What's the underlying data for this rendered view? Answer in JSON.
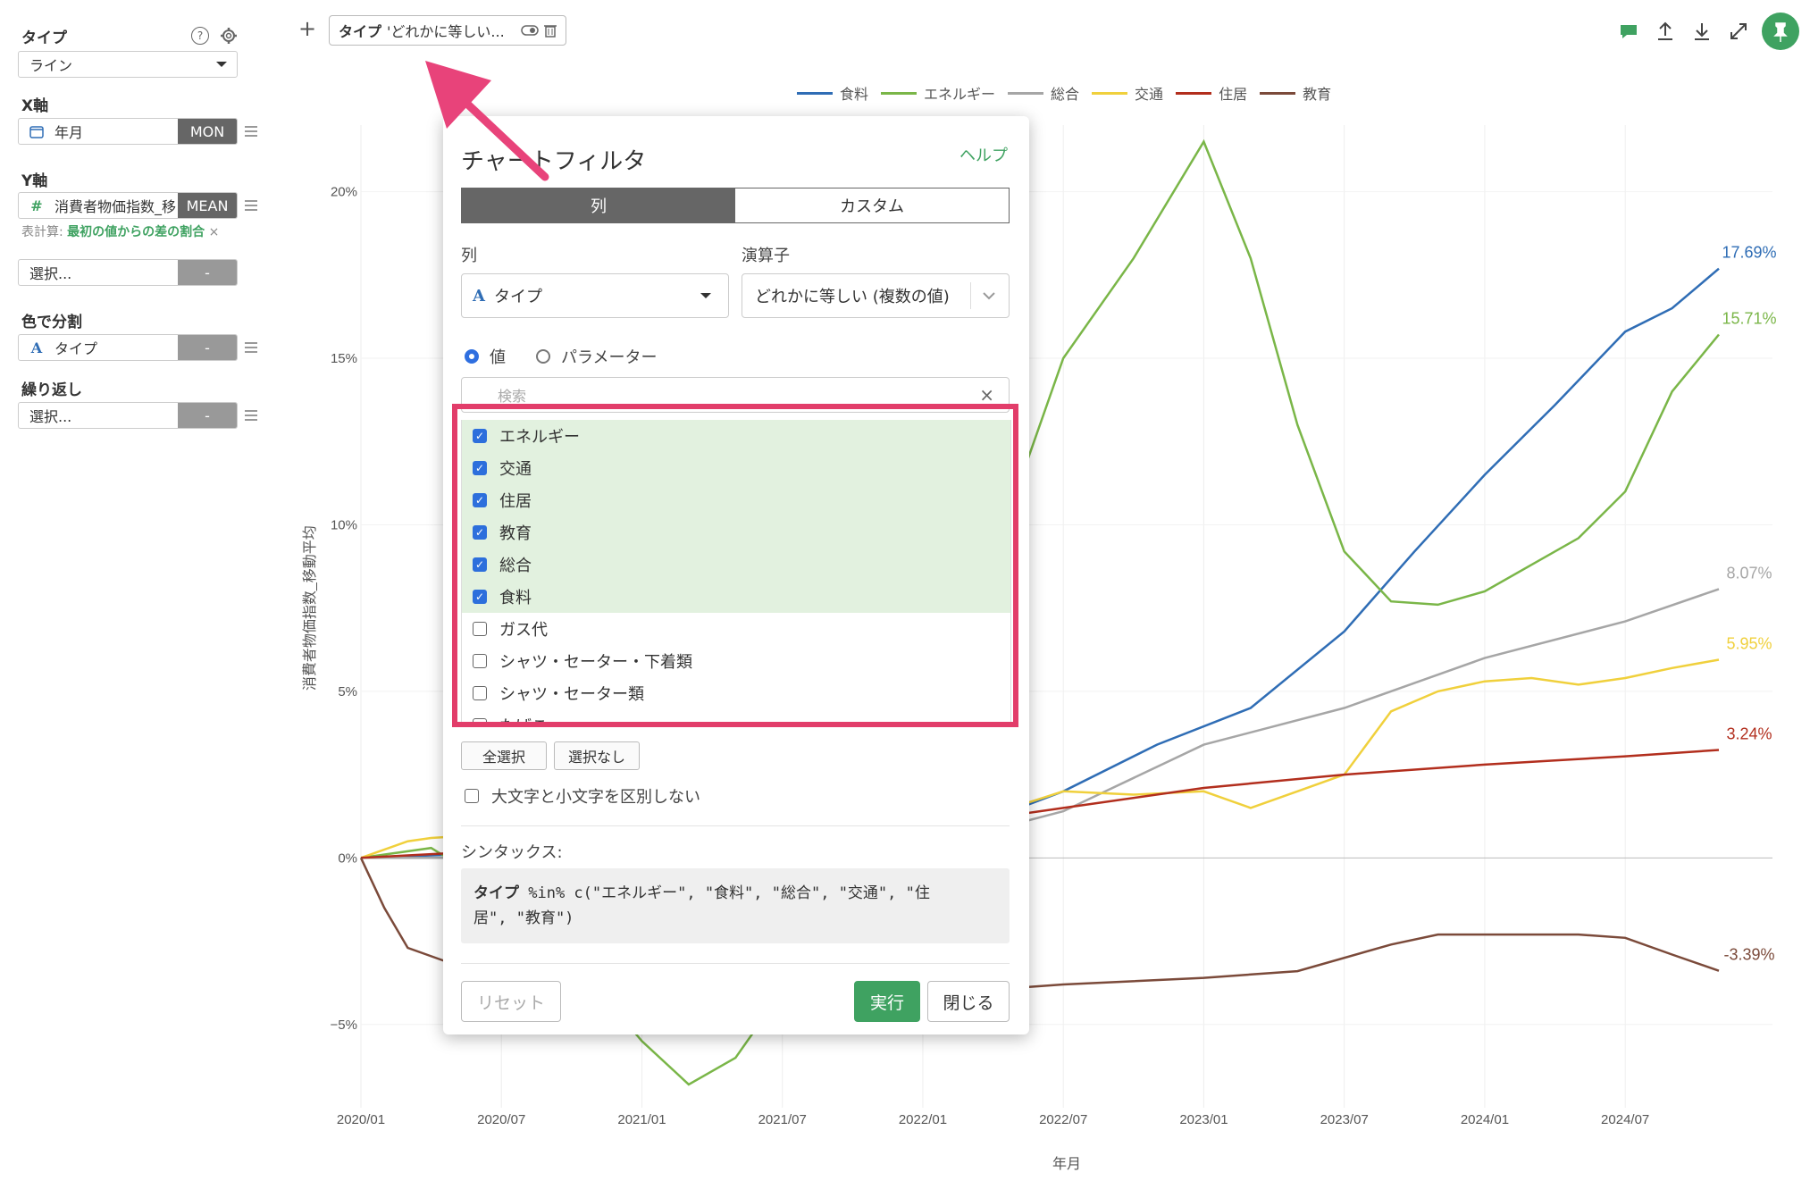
{
  "sidebar": {
    "type_label": "タイプ",
    "type_value": "ライン",
    "x_label": "X軸",
    "x_field": "年月",
    "x_agg": "MON",
    "y_label": "Y軸",
    "y_field": "消費者物価指数_移",
    "y_agg": "MEAN",
    "calc_prefix": "表計算:",
    "calc_value": "最初の値からの差の割合",
    "calc_close": "×",
    "select_placeholder": "選択...",
    "select_tag": "-",
    "color_label": "色で分割",
    "color_field": "タイプ",
    "color_tag": "-",
    "repeat_label": "繰り返し",
    "repeat_placeholder": "選択...",
    "repeat_tag": "-",
    "help_icon": "?"
  },
  "toolbar": {
    "add": "+",
    "filter_chip_key": "タイプ",
    "filter_chip_value": "'どれかに等しい..."
  },
  "dialog": {
    "title": "チャートフィルタ",
    "help": "ヘルプ",
    "tab_column": "列",
    "tab_custom": "カスタム",
    "column_label": "列",
    "column_icon": "A",
    "column_value": "タイプ",
    "operator_label": "演算子",
    "operator_value": "どれかに等しい (複数の値)",
    "radio_value": "値",
    "radio_param": "パラメーター",
    "search_placeholder": "検索",
    "search_clear": "×",
    "items": [
      {
        "label": "エネルギー",
        "checked": true
      },
      {
        "label": "交通",
        "checked": true
      },
      {
        "label": "住居",
        "checked": true
      },
      {
        "label": "教育",
        "checked": true
      },
      {
        "label": "総合",
        "checked": true
      },
      {
        "label": "食料",
        "checked": true
      },
      {
        "label": "ガス代",
        "checked": false
      },
      {
        "label": "シャツ・セーター・下着類",
        "checked": false
      },
      {
        "label": "シャツ・セーター類",
        "checked": false
      },
      {
        "label": "たばこ",
        "checked": false
      }
    ],
    "select_all": "全選択",
    "select_none": "選択なし",
    "case_insensitive": "大文字と小文字を区別しない",
    "syntax_label": "シンタックス:",
    "syntax_key": "タイプ",
    "syntax_line1": " %in% c(\"エネルギー\", \"食料\", \"総合\", \"交通\", \"住",
    "syntax_line2": "居\", \"教育\")",
    "reset": "リセット",
    "run": "実行",
    "close": "閉じる"
  },
  "chart_data": {
    "type": "line",
    "xlabel": "年月",
    "ylabel": "消費者物価指数_移動平均",
    "x_ticks": [
      "2020/01",
      "2020/07",
      "2021/01",
      "2021/07",
      "2022/01",
      "2022/07",
      "2023/01",
      "2023/07",
      "2024/01",
      "2024/07"
    ],
    "y_ticks": [
      "−5%",
      "0%",
      "5%",
      "10%",
      "15%",
      "20%"
    ],
    "ylim": [
      -7.5,
      22
    ],
    "x_range_months": [
      0,
      58
    ],
    "grid": true,
    "legend_position": "top",
    "series": [
      {
        "name": "食料",
        "color": "#2f6db5",
        "end_label": "17.69%",
        "points": [
          [
            0,
            0
          ],
          [
            12,
            0.3
          ],
          [
            24,
            0.6
          ],
          [
            27,
            1.2
          ],
          [
            30,
            2
          ],
          [
            34,
            3.4
          ],
          [
            38,
            4.5
          ],
          [
            42,
            6.8
          ],
          [
            45,
            9.2
          ],
          [
            48,
            11.5
          ],
          [
            51,
            13.6
          ],
          [
            54,
            15.8
          ],
          [
            56,
            16.5
          ],
          [
            58,
            17.69
          ]
        ]
      },
      {
        "name": "エネルギー",
        "color": "#7ab648",
        "end_label": "15.71%",
        "points": [
          [
            0,
            0
          ],
          [
            3,
            0.3
          ],
          [
            6,
            -1
          ],
          [
            9,
            -3
          ],
          [
            12,
            -5.5
          ],
          [
            14,
            -6.8
          ],
          [
            16,
            -6
          ],
          [
            20,
            -2
          ],
          [
            24,
            4
          ],
          [
            27,
            9
          ],
          [
            30,
            15
          ],
          [
            33,
            18
          ],
          [
            36,
            21.5
          ],
          [
            38,
            18
          ],
          [
            40,
            13
          ],
          [
            42,
            9.2
          ],
          [
            44,
            7.7
          ],
          [
            46,
            7.6
          ],
          [
            48,
            8
          ],
          [
            50,
            8.8
          ],
          [
            52,
            9.6
          ],
          [
            54,
            11
          ],
          [
            56,
            14
          ],
          [
            58,
            15.71
          ]
        ]
      },
      {
        "name": "総合",
        "color": "#a6a6a6",
        "end_label": "8.07%",
        "points": [
          [
            0,
            0
          ],
          [
            12,
            0
          ],
          [
            24,
            0.3
          ],
          [
            30,
            1.4
          ],
          [
            36,
            3.4
          ],
          [
            42,
            4.5
          ],
          [
            48,
            6
          ],
          [
            54,
            7.1
          ],
          [
            58,
            8.07
          ]
        ]
      },
      {
        "name": "交通",
        "color": "#f0d03c",
        "end_label": "5.95%",
        "points": [
          [
            0,
            0
          ],
          [
            2,
            0.5
          ],
          [
            3,
            0.6
          ],
          [
            12,
            1
          ],
          [
            24,
            1
          ],
          [
            26,
            1.1
          ],
          [
            30,
            2
          ],
          [
            33,
            1.9
          ],
          [
            36,
            2
          ],
          [
            38,
            1.5
          ],
          [
            40,
            2
          ],
          [
            42,
            2.5
          ],
          [
            44,
            4.4
          ],
          [
            46,
            5
          ],
          [
            48,
            5.3
          ],
          [
            50,
            5.4
          ],
          [
            52,
            5.2
          ],
          [
            54,
            5.4
          ],
          [
            56,
            5.7
          ],
          [
            58,
            5.95
          ]
        ]
      },
      {
        "name": "住居",
        "color": "#b22e1d",
        "end_label": "3.24%",
        "points": [
          [
            0,
            0
          ],
          [
            24,
            0.9
          ],
          [
            30,
            1.5
          ],
          [
            36,
            2.1
          ],
          [
            42,
            2.5
          ],
          [
            48,
            2.8
          ],
          [
            54,
            3.05
          ],
          [
            58,
            3.24
          ]
        ]
      },
      {
        "name": "教育",
        "color": "#7b4a3a",
        "end_label": "-3.39%",
        "points": [
          [
            0,
            0
          ],
          [
            1,
            -1.5
          ],
          [
            2,
            -2.7
          ],
          [
            4,
            -3.2
          ],
          [
            12,
            -3.8
          ],
          [
            24,
            -4.1
          ],
          [
            30,
            -3.8
          ],
          [
            36,
            -3.6
          ],
          [
            40,
            -3.4
          ],
          [
            44,
            -2.6
          ],
          [
            46,
            -2.3
          ],
          [
            48,
            -2.3
          ],
          [
            52,
            -2.3
          ],
          [
            54,
            -2.4
          ],
          [
            56,
            -2.9
          ],
          [
            58,
            -3.39
          ]
        ]
      }
    ]
  }
}
